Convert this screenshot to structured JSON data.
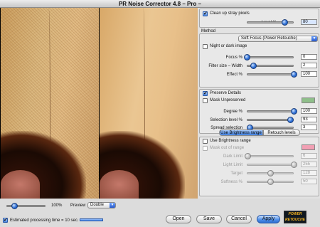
{
  "window": {
    "title": "PR Noise Corrector 4.8 – Pro –"
  },
  "preview": {
    "zoom": "100%",
    "mode_label": "Preview",
    "mode_value": "Double",
    "zoom_slider_fraction": 0.2
  },
  "footer": {
    "estimate_label": "Estimated processing time = 10 sec.",
    "estimate_checked": true,
    "open": "Open",
    "save": "Save",
    "cancel": "Cancel",
    "apply": "Apply",
    "logo_line1": "POWER",
    "logo_line2": "RETOUCHE"
  },
  "stray": {
    "label": "Clean up stray pixels",
    "checked": true,
    "level_label": "Level %",
    "level_value": "80",
    "level_fraction": 0.8
  },
  "method": {
    "label": "Method",
    "selected": "Soft Focus (Power Retouche)",
    "night_label": "Night or dark image",
    "night_checked": false,
    "focus_label": "Focus %",
    "focus_value": "0",
    "focus_fraction": 0.0,
    "filter_label": "Filter size – Width",
    "filter_value": "2",
    "filter_fraction": 0.13,
    "effect_label": "Effect %",
    "effect_value": "100",
    "effect_fraction": 1.0
  },
  "details": {
    "label": "Preserve Details",
    "checked": true,
    "mask_label": "Mask Unpreserved",
    "mask_checked": false,
    "mask_color": "#8fbf8a",
    "degree_label": "Degree %",
    "degree_value": "100",
    "degree_fraction": 1.0,
    "selection_label": "Selection level %",
    "selection_value": "93",
    "selection_fraction": 0.93,
    "spread_label": "Spread selection",
    "spread_value": "3",
    "spread_fraction": 0.06
  },
  "tabs": [
    {
      "label": "Use Brightness range"
    },
    {
      "label": "Retouch levels"
    }
  ],
  "brightness": {
    "use_label": "Use Brightness range",
    "use_checked": false,
    "mask_label": "Mask out of range",
    "mask_color": "#f2a0b4",
    "dark_label": "Dark Limit",
    "dark_value": "6",
    "dark_fraction": 0.02,
    "light_label": "Light Limit",
    "light_value": "255",
    "light_fraction": 1.0,
    "target_label": "Target",
    "target_value": "128",
    "target_fraction": 0.5,
    "softness_label": "Softness %",
    "softness_value": "50",
    "softness_fraction": 0.5
  }
}
